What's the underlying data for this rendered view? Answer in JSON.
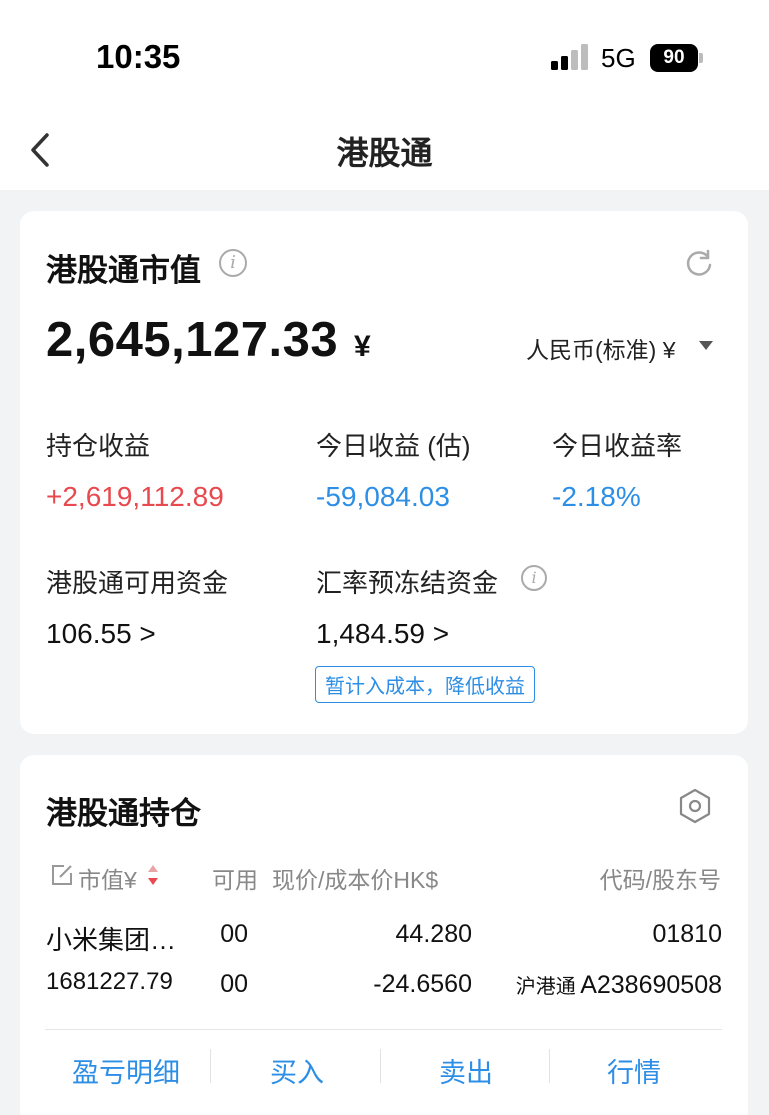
{
  "status_bar": {
    "time": "10:35",
    "network": "5G",
    "battery": "90"
  },
  "nav": {
    "title": "港股通",
    "back_icon": "chevron-left-icon"
  },
  "market_value_card": {
    "title": "港股通市值",
    "value": "2,645,127.33",
    "currency_symbol": "¥",
    "currency_select": "人民币(标准) ¥",
    "refresh_icon": "refresh-icon",
    "info_icon": "info-icon",
    "stats": [
      {
        "label": "持仓收益",
        "value": "+2,619,112.89",
        "color": "#e8494e"
      },
      {
        "label": "今日收益 (估)",
        "value": "-59,084.03",
        "color": "#2d8ee6"
      },
      {
        "label": "今日收益率",
        "value": "-2.18%",
        "color": "#2d8ee6"
      }
    ],
    "available_funds": {
      "label": "港股通可用资金",
      "value": "106.55 >"
    },
    "frozen_funds": {
      "label": "汇率预冻结资金",
      "value": "1,484.59 >",
      "tag": "暂计入成本，降低收益"
    }
  },
  "holdings_card": {
    "title": "港股通持仓",
    "settings_icon": "hexagon-settings-icon",
    "headers": {
      "market_value": "市值¥",
      "available": "可用",
      "price": "现价/成本价HK$",
      "code": "代码/股东号"
    },
    "rows": [
      {
        "name": "小米集团…",
        "market_value": "1681227.79",
        "available_1": "00",
        "available_2": "00",
        "price": "44.280",
        "cost": "-24.6560",
        "code": "01810",
        "account_prefix": "沪港通",
        "account": "A238690508"
      }
    ],
    "actions": [
      "盈亏明细",
      "买入",
      "卖出",
      "行情"
    ]
  },
  "colors": {
    "accent": "#2d8ee6",
    "gain": "#e8494e",
    "background": "#f2f3f5"
  }
}
